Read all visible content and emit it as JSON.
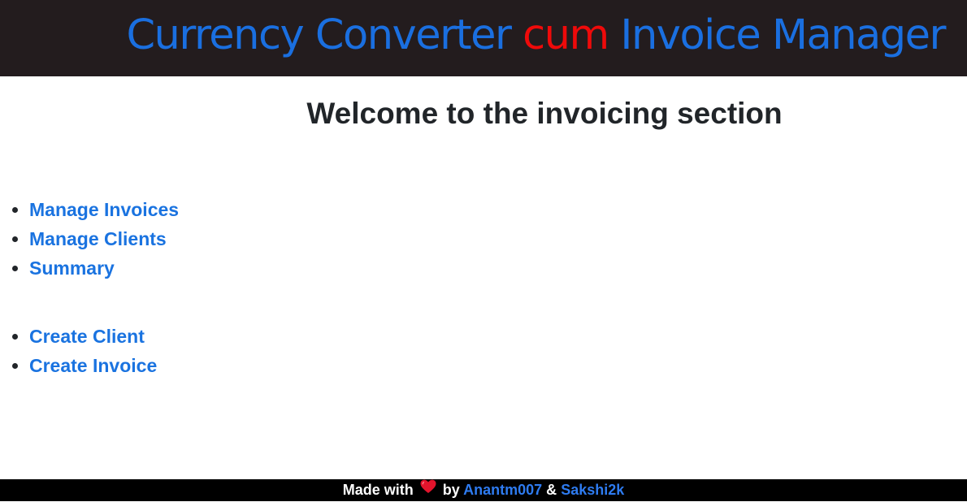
{
  "header": {
    "title_part1": "Currency Converter ",
    "title_accent": "cum",
    "title_part2": " Invoice Manager",
    "accent_color": "#ef0a0a",
    "title_color": "#1a6fe0",
    "background": "#231c1e"
  },
  "main": {
    "welcome": "Welcome to the invoicing section",
    "primary_links": [
      {
        "label": "Manage Invoices"
      },
      {
        "label": "Manage Clients"
      },
      {
        "label": "Summary"
      }
    ],
    "create_links": [
      {
        "label": "Create Client"
      },
      {
        "label": "Create Invoice"
      }
    ],
    "link_color": "#1a73e0"
  },
  "footer": {
    "made_with": "Made with",
    "heart_icon": "heart-icon",
    "by": "by",
    "author1": "Anantm007",
    "ampersand": "&",
    "author2": "Sakshi2k"
  }
}
